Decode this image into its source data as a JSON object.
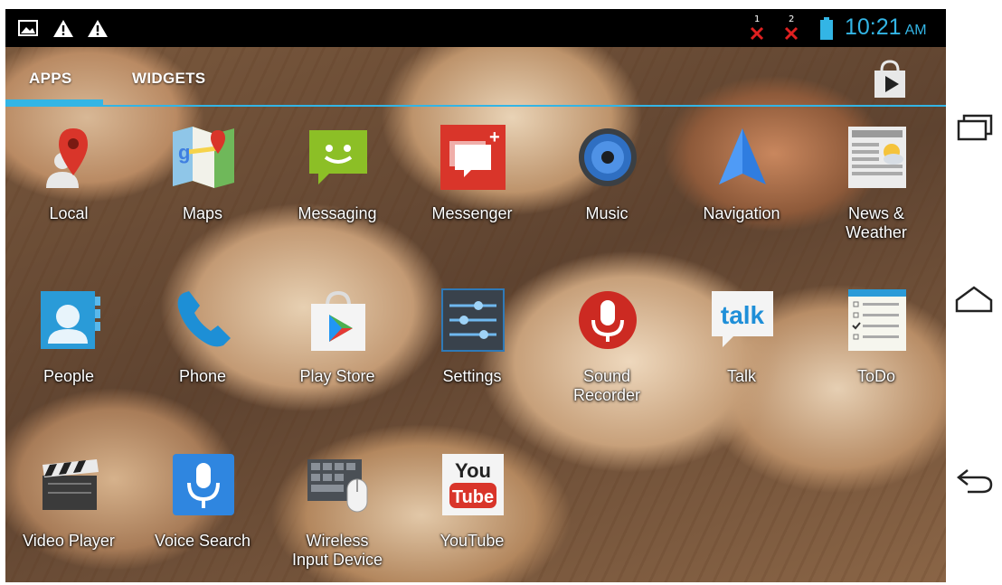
{
  "status_bar": {
    "icons": [
      "gallery-notification-icon",
      "warning-icon",
      "warning-icon"
    ],
    "sim_indicators": [
      "1",
      "2"
    ],
    "clock_time": "10:21",
    "clock_ampm": "AM",
    "accent": "#33b5e5"
  },
  "tabs": [
    {
      "label": "APPS",
      "selected": true
    },
    {
      "label": "WIDGETS",
      "selected": false
    }
  ],
  "store_icon": "play-store-bag-icon",
  "apps": [
    {
      "label": "Local",
      "icon": "local-pin-icon"
    },
    {
      "label": "Maps",
      "icon": "maps-icon"
    },
    {
      "label": "Messaging",
      "icon": "messaging-icon"
    },
    {
      "label": "Messenger",
      "icon": "messenger-icon"
    },
    {
      "label": "Music",
      "icon": "music-icon"
    },
    {
      "label": "Navigation",
      "icon": "navigation-icon"
    },
    {
      "label": "News & Weather",
      "icon": "news-weather-icon"
    },
    {
      "label": "People",
      "icon": "people-icon"
    },
    {
      "label": "Phone",
      "icon": "phone-icon"
    },
    {
      "label": "Play Store",
      "icon": "play-store-icon"
    },
    {
      "label": "Settings",
      "icon": "settings-icon"
    },
    {
      "label": "Sound Recorder",
      "icon": "sound-recorder-icon"
    },
    {
      "label": "Talk",
      "icon": "talk-icon"
    },
    {
      "label": "ToDo",
      "icon": "todo-icon"
    },
    {
      "label": "Video Player",
      "icon": "video-player-icon"
    },
    {
      "label": "Voice Search",
      "icon": "voice-search-icon"
    },
    {
      "label": "Wireless Input Device",
      "icon": "wireless-input-device-icon"
    },
    {
      "label": "YouTube",
      "icon": "youtube-icon"
    }
  ],
  "youtube_logo": {
    "top": "You",
    "bottom": "Tube"
  },
  "talk_logo": "talk",
  "nav_buttons": [
    "recent-apps-icon",
    "home-icon",
    "back-icon"
  ]
}
